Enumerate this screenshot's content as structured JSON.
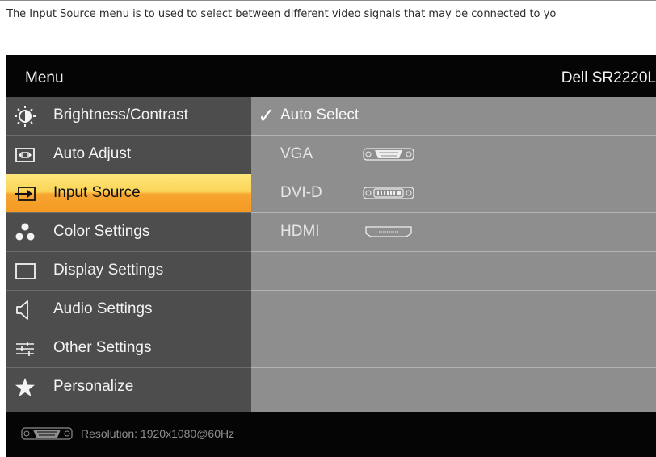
{
  "intro_text": "The Input Source menu is to used to select between different video signals that may be connected to yo",
  "header": {
    "menu_label": "Menu",
    "model": "Dell SR2220L"
  },
  "menu_items": [
    {
      "label": "Brightness/Contrast",
      "icon": "brightness-icon"
    },
    {
      "label": "Auto Adjust",
      "icon": "auto-adjust-icon"
    },
    {
      "label": "Input Source",
      "icon": "input-source-icon",
      "selected": true
    },
    {
      "label": "Color Settings",
      "icon": "color-settings-icon"
    },
    {
      "label": "Display Settings",
      "icon": "display-settings-icon"
    },
    {
      "label": "Audio Settings",
      "icon": "speaker-icon"
    },
    {
      "label": "Other Settings",
      "icon": "sliders-icon"
    },
    {
      "label": "Personalize",
      "icon": "star-icon"
    }
  ],
  "input_options": [
    {
      "label": "Auto Select",
      "checked": true
    },
    {
      "label": "VGA",
      "connector": "vga-connector-icon"
    },
    {
      "label": "DVI-D",
      "connector": "dvi-connector-icon"
    },
    {
      "label": "HDMI",
      "connector": "hdmi-connector-icon"
    }
  ],
  "footer": {
    "resolution": "Resolution: 1920x1080@60Hz"
  },
  "colors": {
    "header_bg": "#050505",
    "left_panel": "#4d4d4d",
    "right_panel": "#8e8e8e",
    "highlight": "#f7a531"
  }
}
